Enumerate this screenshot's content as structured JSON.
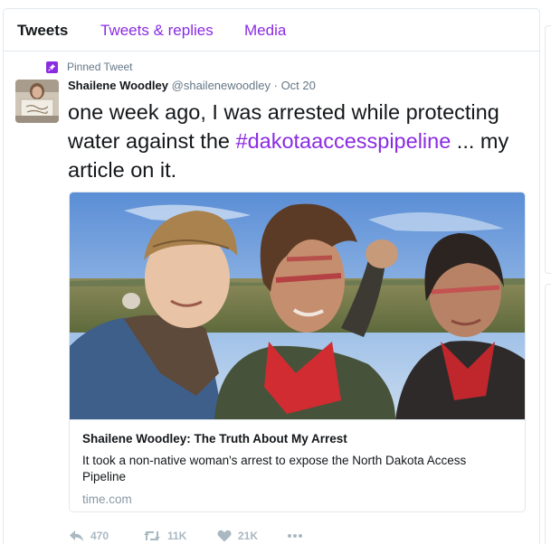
{
  "tabs": [
    {
      "label": "Tweets",
      "active": true
    },
    {
      "label": "Tweets & replies",
      "active": false
    },
    {
      "label": "Media",
      "active": false
    }
  ],
  "tweet": {
    "pinned_label": "Pinned Tweet",
    "author_name": "Shailene Woodley",
    "handle": "@shailenewoodley",
    "separator": "·",
    "date": "Oct 20",
    "text_before": "one week ago, I was arrested while protecting water against the ",
    "hashtag": "#dakotaaccesspipeline",
    "text_after": " ... my article on it.",
    "avatar_icon": "profile-photo",
    "card": {
      "title": "Shailene Woodley: The Truth About My Arrest",
      "description": "It took a non-native woman's arrest to expose the North Dakota Access Pipeline",
      "domain": "time.com",
      "image_icon": "three-women-selfie-photo"
    },
    "actions": {
      "reply_count": "470",
      "retweet_count": "11K",
      "like_count": "21K"
    }
  },
  "colors": {
    "accent": "#8a2be2",
    "text": "#14171a",
    "muted": "#657786",
    "action": "#aab8c2",
    "border": "#e1e8ed"
  }
}
